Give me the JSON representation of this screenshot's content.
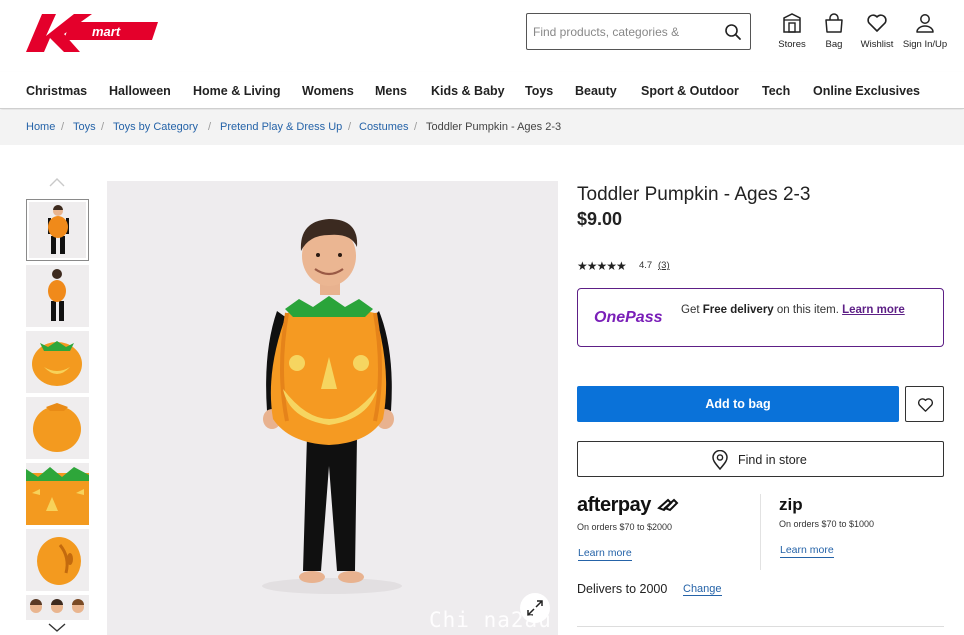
{
  "header": {
    "logo_text": "mart",
    "search": {
      "placeholder": "Find products, categories &"
    },
    "icons": [
      {
        "label": "Stores",
        "icon": "store-icon"
      },
      {
        "label": "Bag",
        "icon": "bag-icon"
      },
      {
        "label": "Wishlist",
        "icon": "heart-icon"
      },
      {
        "label": "Sign In/Up",
        "icon": "user-icon"
      }
    ],
    "brand_color": "#e4002b"
  },
  "nav": {
    "items": [
      "Christmas",
      "Halloween",
      "Home & Living",
      "Womens",
      "Mens",
      "Kids & Baby",
      "Toys",
      "Beauty",
      "Sport & Outdoor",
      "Tech",
      "Online Exclusives"
    ]
  },
  "breadcrumb": {
    "links": [
      "Home",
      "Toys",
      "Toys by Category",
      "Pretend Play & Dress Up",
      "Costumes"
    ],
    "separator": "/",
    "current": "Toddler Pumpkin - Ages 2-3"
  },
  "gallery": {
    "thumbnail_count": 7,
    "selected_index": 0,
    "watermark": "Chi na2au"
  },
  "product": {
    "title": "Toddler Pumpkin - Ages 2-3",
    "price": "$9.00",
    "stars": "★★★★★",
    "rating": "4.7",
    "review_count": "(3)",
    "rating_value": 4.7
  },
  "onepass": {
    "logo": "OnePass",
    "text_before": "Get ",
    "text_bold": "Free delivery",
    "text_after": " on this item. ",
    "link": "Learn more",
    "color": "#5d1f86"
  },
  "actions": {
    "add_to_bag": "Add to bag",
    "find_in_store": "Find in store",
    "primary_color": "#0a72d9"
  },
  "payments": {
    "afterpay": {
      "logo": "afterpay",
      "note": "On orders $70 to $2000",
      "link": "Learn more"
    },
    "zip": {
      "logo": "zip",
      "note": "On orders $70 to $1000",
      "link": "Learn more"
    }
  },
  "delivery": {
    "text": "Delivers to 2000",
    "change_link": "Change"
  }
}
